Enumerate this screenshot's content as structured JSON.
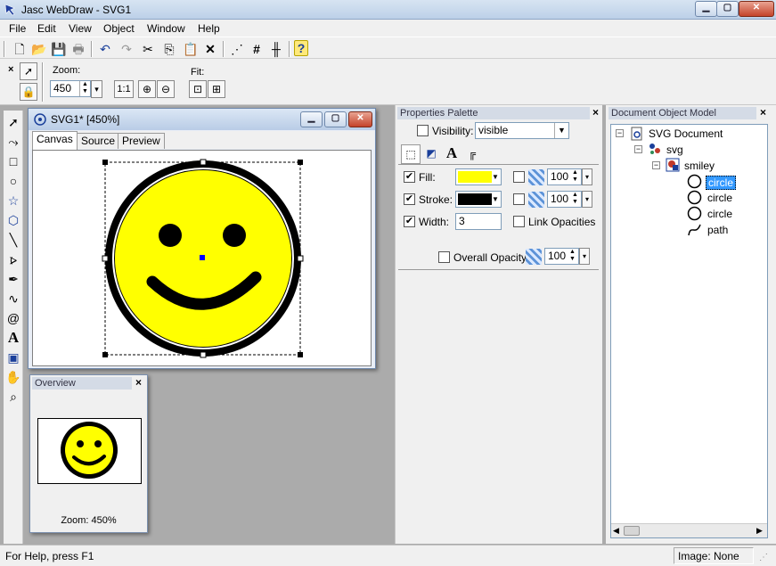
{
  "window": {
    "title": "Jasc WebDraw - SVG1"
  },
  "menu": [
    "File",
    "Edit",
    "View",
    "Object",
    "Window",
    "Help"
  ],
  "zoombar": {
    "zoom_label": "Zoom:",
    "zoom_value": "450",
    "one_to_one": "1:1",
    "fit_label": "Fit:"
  },
  "svg_window": {
    "title": "SVG1* [450%]",
    "tabs": [
      "Canvas",
      "Source",
      "Preview"
    ],
    "active_tab": "Canvas"
  },
  "overview": {
    "title": "Overview",
    "zoom_text": "Zoom: 450%"
  },
  "properties": {
    "title": "Properties Palette",
    "visibility_label": "Visibility:",
    "visibility_value": "visible",
    "fill_label": "Fill:",
    "fill_color": "#ffff00",
    "fill_opacity": "100",
    "stroke_label": "Stroke:",
    "stroke_color": "#000000",
    "stroke_opacity": "100",
    "width_label": "Width:",
    "width_value": "3",
    "link_opacities_label": "Link Opacities",
    "overall_opacity_label": "Overall Opacity:",
    "overall_opacity_value": "100"
  },
  "dom": {
    "title": "Document Object Model",
    "root": "SVG Document",
    "svg": "svg",
    "group": "smiley",
    "children": [
      "circle",
      "circle",
      "circle",
      "path"
    ],
    "selected_index": 0
  },
  "status": {
    "help": "For Help, press F1",
    "image": "Image: None"
  },
  "colors": {
    "accent": "#3399ff",
    "smiley_fill": "#ffff00"
  }
}
